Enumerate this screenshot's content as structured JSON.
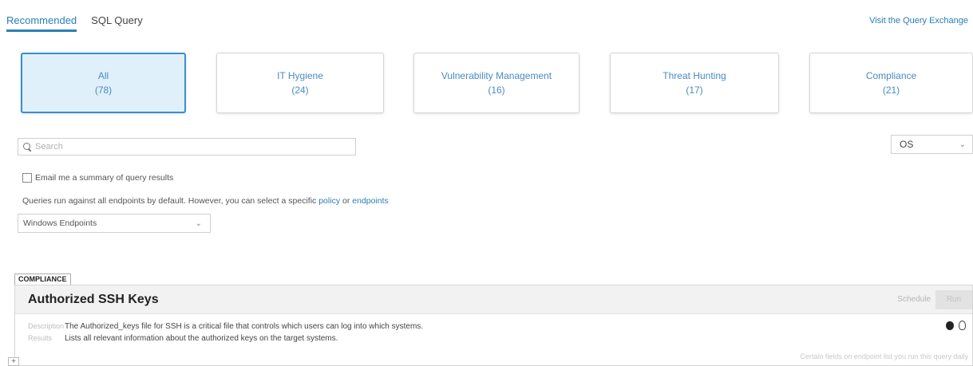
{
  "tabs": [
    {
      "label": "Recommended",
      "active": true
    },
    {
      "label": "SQL Query",
      "active": false
    }
  ],
  "header": {
    "exchange_link": "Visit the Query Exchange"
  },
  "categories": [
    {
      "name": "All",
      "count": "(78)",
      "selected": true
    },
    {
      "name": "IT Hygiene",
      "count": "(24)",
      "selected": false
    },
    {
      "name": "Vulnerability Management",
      "count": "(16)",
      "selected": false
    },
    {
      "name": "Threat Hunting",
      "count": "(17)",
      "selected": false
    },
    {
      "name": "Compliance",
      "count": "(21)",
      "selected": false
    }
  ],
  "search": {
    "placeholder": "Search",
    "value": ""
  },
  "os_filter": {
    "selected": "OS"
  },
  "email": {
    "label": "Email me a summary of query results",
    "checked": false
  },
  "info": {
    "text": "Queries run against all endpoints by default. However, you can select a specific",
    "policy_link": "policy",
    "or": "or",
    "endpoints_link": "endpoints"
  },
  "endpoint_select": {
    "selected": "Windows Endpoints"
  },
  "query": {
    "category": "COMPLIANCE",
    "title": "Authorized SSH Keys",
    "schedule_label": "Schedule",
    "run_label": "Run",
    "description_label": "Description",
    "description": "The Authorized_keys file for SSH is a critical file that controls which users can log into which systems.",
    "results_label": "Results",
    "results": "Lists all relevant information about the authorized keys on the target systems.",
    "platforms": [
      "apple-icon",
      "linux-icon"
    ]
  },
  "add_label": "+",
  "footer_note": "Certain fields on endpoint list you run this query daily"
}
